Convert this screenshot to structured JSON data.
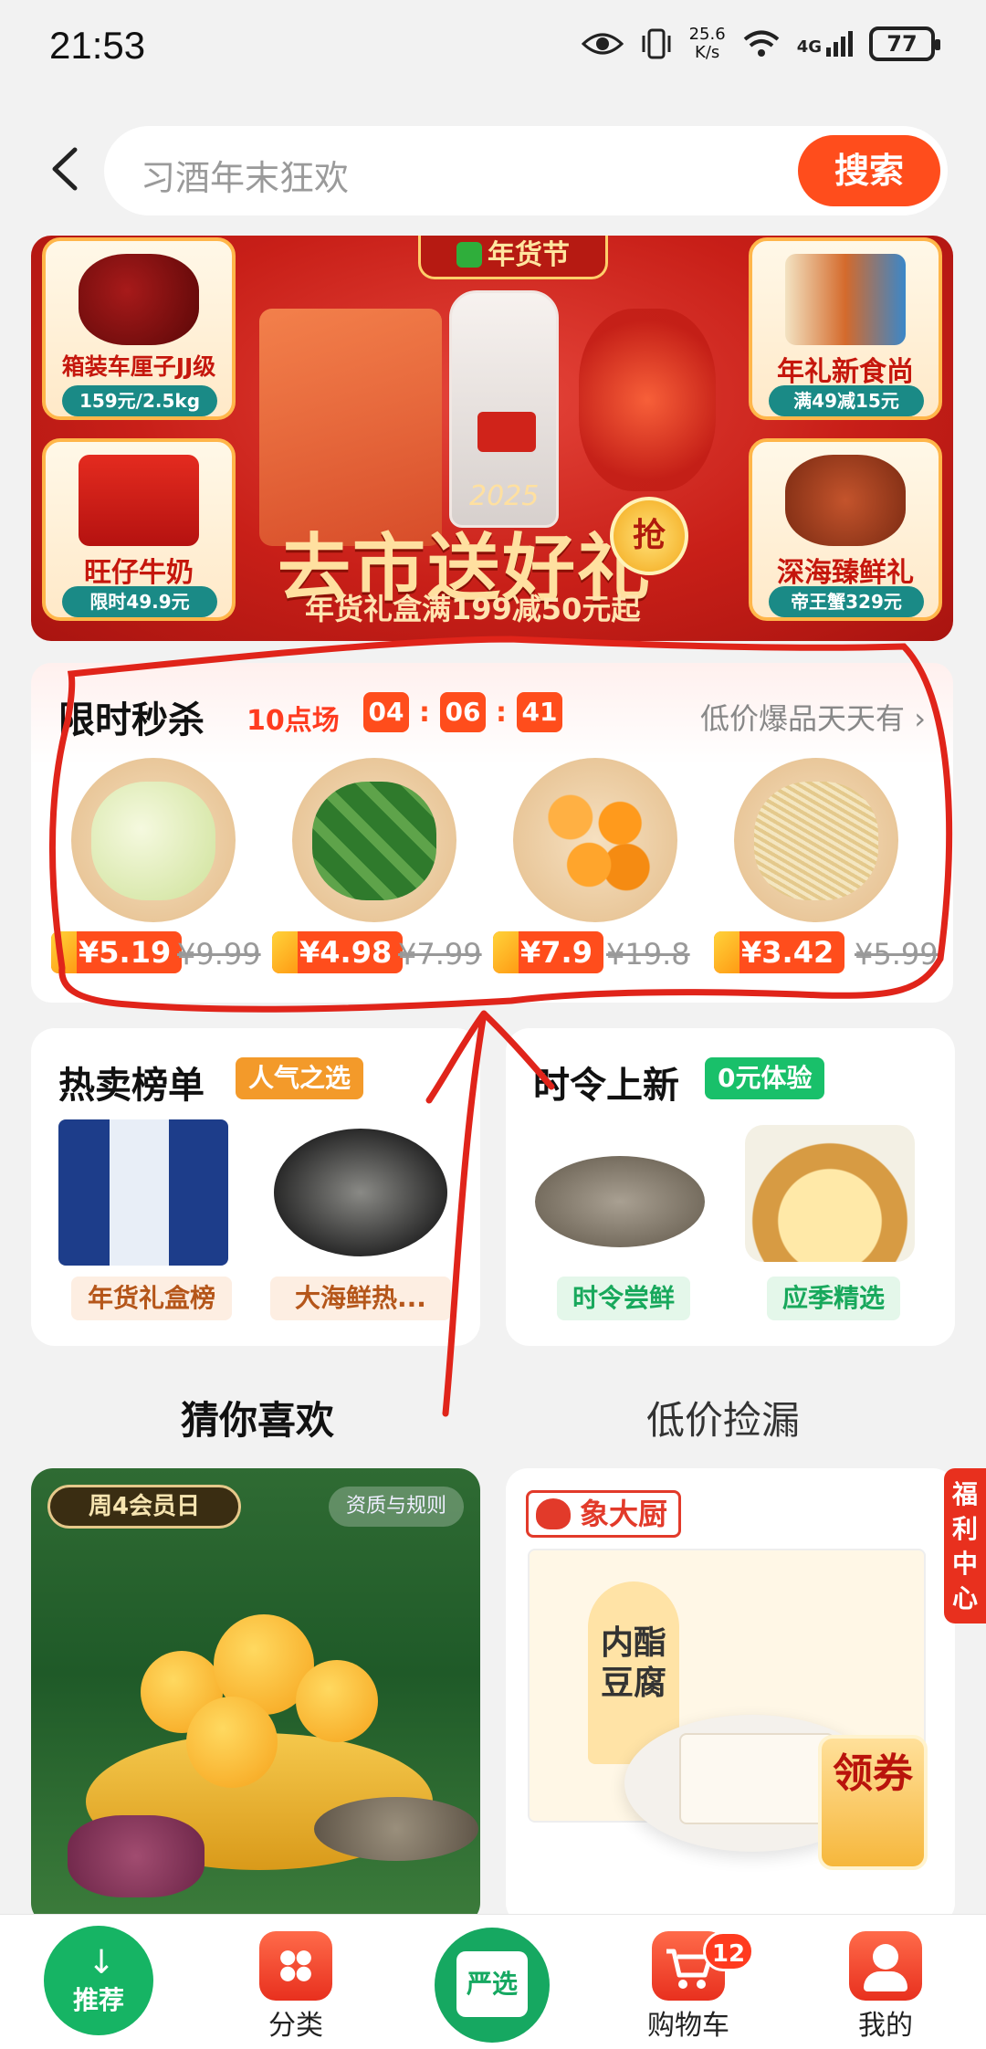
{
  "status": {
    "time": "21:53",
    "net_speed_value": "25.6",
    "net_speed_unit": "K/s",
    "network": "4G",
    "battery": "77"
  },
  "search": {
    "placeholder": "习酒年末狂欢",
    "button": "搜索"
  },
  "banner": {
    "festival_tag": "年货节",
    "year": "2025",
    "slogan": "去市送好礼",
    "grab": "抢",
    "subtitle": "年货礼盒满199减50元起",
    "tiles": [
      {
        "name": "箱装车厘子JJ级",
        "price": "159元/2.5kg"
      },
      {
        "name": "年礼新食尚",
        "price": "满49减15元"
      },
      {
        "name": "旺仔牛奶",
        "price": "限时49.9元"
      },
      {
        "name": "深海臻鲜礼",
        "price": "帝王蟹329元"
      }
    ]
  },
  "flash_sale": {
    "title": "限时秒杀",
    "session": "10点场",
    "countdown": {
      "h": "04",
      "m": "06",
      "s": "41"
    },
    "more": "低价爆品天天有",
    "products": [
      {
        "price": "¥5.19",
        "was": "¥9.99",
        "color": "#e9f2c9"
      },
      {
        "price": "¥4.98",
        "was": "¥7.99",
        "color": "#3f8d3a"
      },
      {
        "price": "¥7.9",
        "was": "¥19.8",
        "color": "#f79522"
      },
      {
        "price": "¥3.42",
        "was": "¥5.99",
        "color": "#f3e2b6"
      }
    ]
  },
  "hot_list": {
    "title": "热卖榜单",
    "tag": "人气之选",
    "items": [
      "年货礼盒榜",
      "大海鲜热..."
    ]
  },
  "new_season": {
    "title": "时令上新",
    "tag": "0元体验",
    "items": [
      "时令尝鲜",
      "应季精选"
    ]
  },
  "tabs": [
    "猜你喜欢",
    "低价捡漏"
  ],
  "feed": {
    "left": {
      "badge": "周4会员日",
      "rules": "资质与规则"
    },
    "right": {
      "brand": "象大厨",
      "product": "内酯豆腐",
      "coupon": "领券",
      "welfare": "福利中心"
    }
  },
  "nav": {
    "items": [
      "推荐",
      "分类",
      "严选",
      "购物车",
      "我的"
    ],
    "cart_count": "12"
  },
  "colors": {
    "accent": "#ff4d1c",
    "green": "#16b464",
    "annotation": "#e0241a"
  }
}
